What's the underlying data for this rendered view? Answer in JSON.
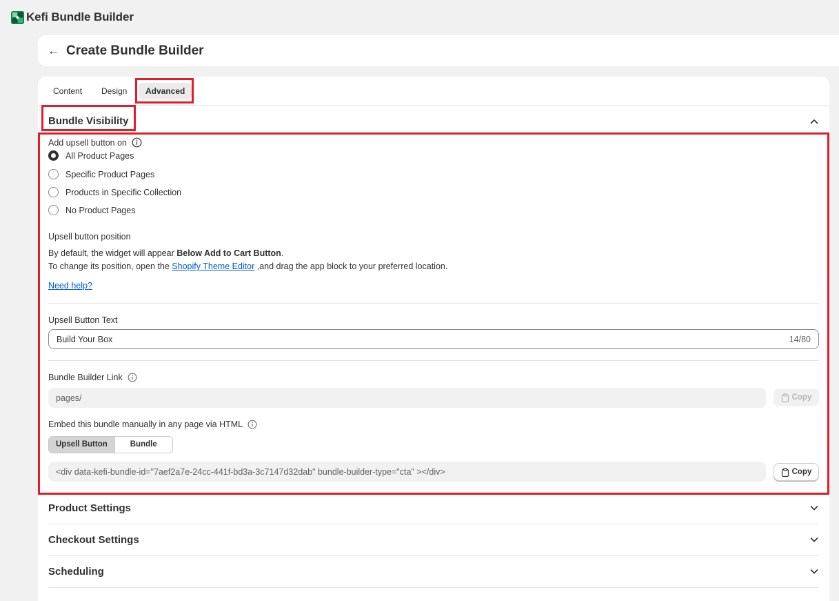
{
  "app": {
    "title": "Kefi Bundle Builder",
    "logo_icon": "kefi-logo-icon"
  },
  "page": {
    "title": "Create Bundle Builder",
    "back_icon": "arrow-left-icon"
  },
  "tabs": [
    {
      "label": "Content",
      "active": false
    },
    {
      "label": "Design",
      "active": false
    },
    {
      "label": "Advanced",
      "active": true
    }
  ],
  "bundle_visibility": {
    "title": "Bundle Visibility",
    "add_upsell_label": "Add upsell button on",
    "options": [
      {
        "label": "All Product Pages",
        "selected": true
      },
      {
        "label": "Specific Product Pages",
        "selected": false
      },
      {
        "label": "Products in Specific Collection",
        "selected": false
      },
      {
        "label": "No Product Pages",
        "selected": false
      }
    ],
    "position_label": "Upsell button position",
    "position_line1_prefix": "By default, the widget will appear ",
    "position_line1_bold": "Below Add to Cart Button",
    "position_line1_suffix": ".",
    "position_line2_prefix": "To change its position, open the ",
    "theme_editor_link": "Shopify Theme Editor",
    "position_line2_suffix": " ,and drag the app block to your preferred location.",
    "need_help": "Need help?",
    "upsell_text_label": "Upsell Button Text",
    "upsell_text_value": "Build Your Box",
    "upsell_text_counter": "14/80",
    "link_label": "Bundle Builder Link",
    "link_value": "pages/",
    "copy_label": "Copy",
    "embed_label": "Embed this bundle manually in any page via HTML",
    "embed_tabs": [
      {
        "label": "Upsell Button",
        "active": true
      },
      {
        "label": "Bundle",
        "active": false
      }
    ],
    "embed_code": "<div data-kefi-bundle-id=\"7aef2a7e-24cc-441f-bd3a-3c7147d32dab\" bundle-builder-type=\"cta\" ></div>",
    "embed_copy_label": "Copy"
  },
  "collapsed_sections": [
    {
      "title": "Product Settings"
    },
    {
      "title": "Checkout Settings"
    },
    {
      "title": "Scheduling"
    }
  ],
  "colors": {
    "highlight": "#e11d2a",
    "link": "#005bd3",
    "text": "#303030"
  }
}
